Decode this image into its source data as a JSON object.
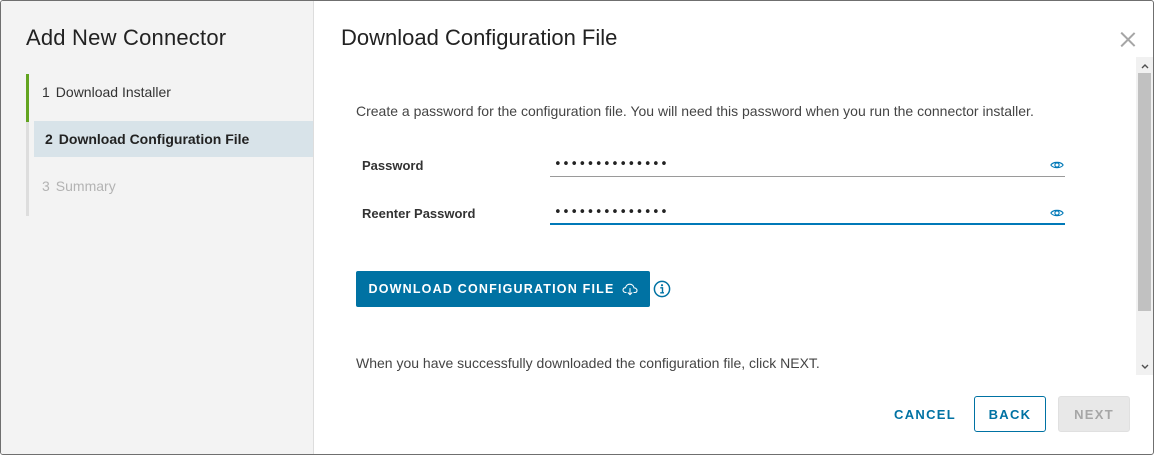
{
  "wizard": {
    "title": "Add New Connector",
    "steps": [
      {
        "number": "1",
        "label": "Download Installer",
        "state": "completed"
      },
      {
        "number": "2",
        "label": "Download Configuration File",
        "state": "active"
      },
      {
        "number": "3",
        "label": "Summary",
        "state": "disabled"
      }
    ]
  },
  "page": {
    "title": "Download Configuration File",
    "intro": "Create a password for the configuration file. You will need this password when you run the connector installer.",
    "password": {
      "label": "Password",
      "value": "••••••••••••••",
      "icon": "eye-icon"
    },
    "reenter_password": {
      "label": "Reenter Password",
      "value": "••••••••••••••",
      "icon": "eye-icon"
    },
    "download_button": {
      "label": "DOWNLOAD CONFIGURATION FILE",
      "icon": "cloud-download-icon"
    },
    "info_icon": "info-icon",
    "note": "When you have successfully downloaded the configuration file, click NEXT."
  },
  "footer": {
    "cancel_label": "CANCEL",
    "back_label": "BACK",
    "next_label": "NEXT"
  },
  "colors": {
    "primary": "#0072a3",
    "completed_step": "#62a420",
    "active_step_bg": "#d8e3e9",
    "disabled_text": "#b3b3b3"
  }
}
